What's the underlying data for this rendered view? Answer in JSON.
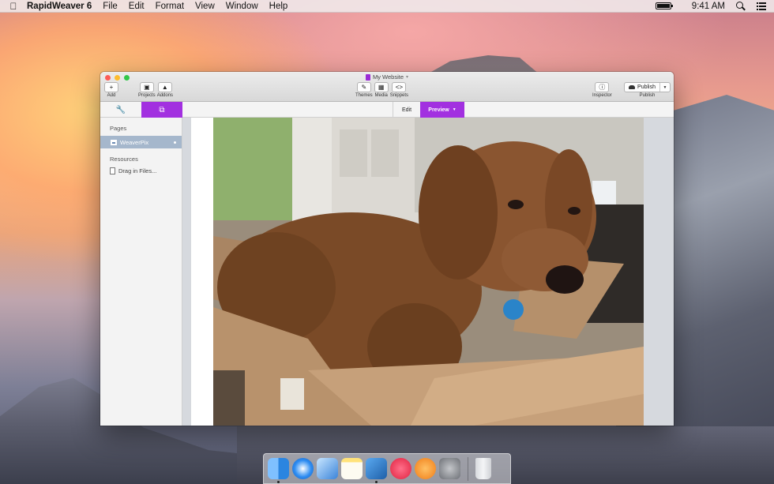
{
  "menubar": {
    "app_name": "RapidWeaver 6",
    "menus": [
      "File",
      "Edit",
      "Format",
      "View",
      "Window",
      "Help"
    ],
    "clock": "9:41 AM"
  },
  "window": {
    "title": "My Website",
    "toolbar": {
      "add": "Add",
      "projects": "Projects",
      "addons": "Addons",
      "themes": "Themes",
      "media": "Media",
      "snippets": "Snippets",
      "inspector": "Inspector",
      "publish_button": "Publish",
      "publish_label": "Publish"
    },
    "mode_tabs": {
      "edit": "Edit",
      "preview": "Preview"
    },
    "sidebar": {
      "pages_header": "Pages",
      "pages": [
        {
          "label": "WeaverPix"
        }
      ],
      "resources_header": "Resources",
      "resources_hint": "Drag in Files..."
    }
  },
  "dock": {
    "apps": [
      "finder-icon",
      "safari-icon",
      "mail-icon",
      "notes-icon",
      "xcode-icon",
      "itunes-icon",
      "ibooks-icon",
      "system-preferences-icon",
      "trash-icon"
    ]
  },
  "colors": {
    "accent": "#a230e0",
    "sidebar_selection": "#a5b7cc"
  }
}
